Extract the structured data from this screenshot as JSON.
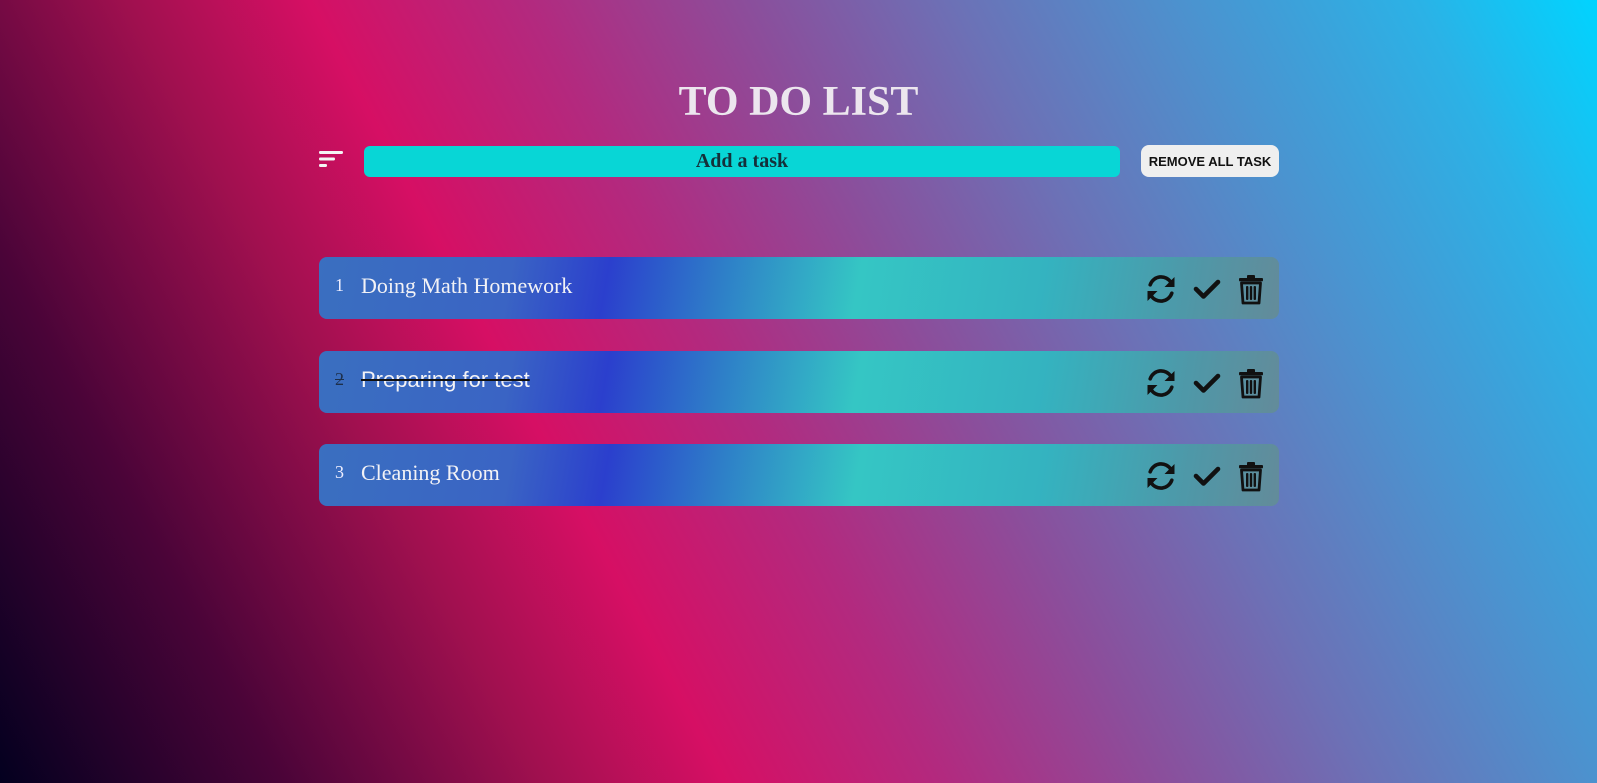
{
  "app": {
    "title": "TO DO LIST"
  },
  "toolbar": {
    "sort_icon": "sort-lines-icon",
    "input_placeholder": "Add a task",
    "input_value": "",
    "remove_all_label": "REMOVE ALL TASK"
  },
  "tasks": [
    {
      "number": "1",
      "text": "Doing Math Homework",
      "completed": false
    },
    {
      "number": "2",
      "text": "Preparing for test",
      "completed": true
    },
    {
      "number": "3",
      "text": "Cleaning Room",
      "completed": false
    }
  ],
  "task_actions": {
    "icons": [
      "sync-icon",
      "check-icon",
      "trash-icon"
    ]
  },
  "colors": {
    "input_bg": "#08d6d6",
    "title": "#ece6ee",
    "button_bg": "#efefef"
  }
}
